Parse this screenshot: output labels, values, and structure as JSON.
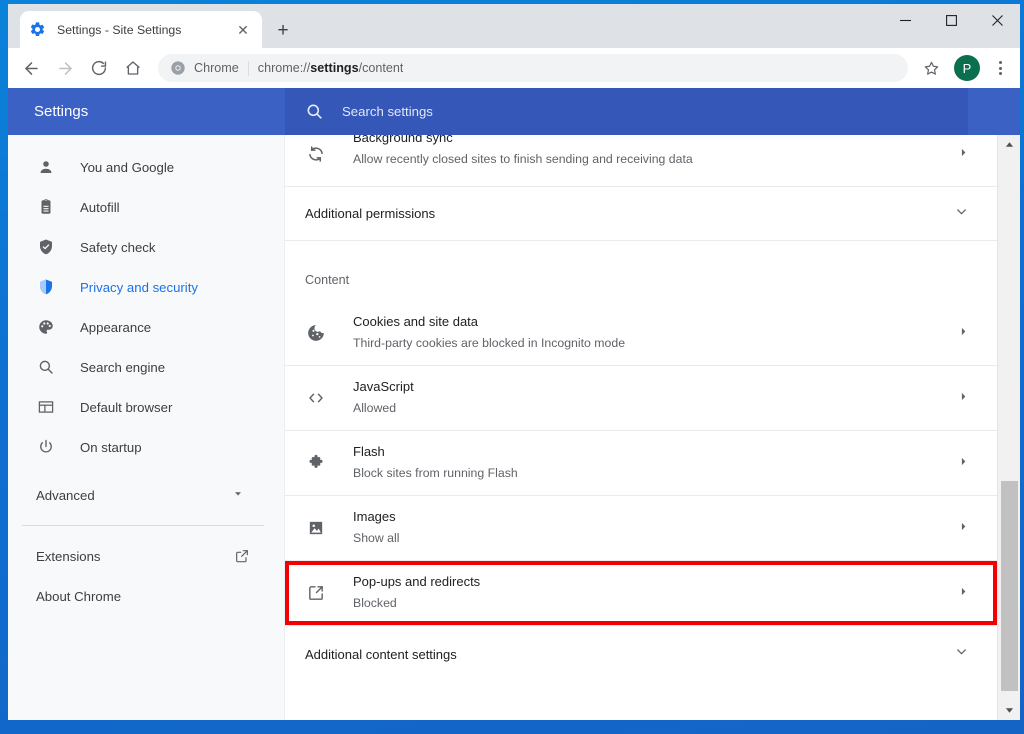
{
  "window": {
    "controls": {
      "minimize": "minimize-icon",
      "maximize": "maximize-icon",
      "close": "close-icon"
    }
  },
  "tab": {
    "title": "Settings - Site Settings",
    "favicon": "gear-icon",
    "close_label": "✕",
    "new_tab_label": "+"
  },
  "toolbar": {
    "back": "back-arrow-icon",
    "forward": "forward-arrow-icon",
    "reload": "reload-icon",
    "home": "home-icon",
    "omnibox": {
      "scheme_label": "Chrome",
      "url_prefix": "chrome://",
      "url_bold": "settings",
      "url_suffix": "/content",
      "full_url": "chrome://settings/content"
    },
    "bookmark": "star-icon",
    "profile_initial": "P",
    "menu": "three-dot-menu-icon"
  },
  "settings_header": {
    "title": "Settings",
    "search_placeholder": "Search settings",
    "search_icon": "search-icon",
    "bg_color": "#3b61c4",
    "search_bg_color": "#3557b8"
  },
  "sidebar": {
    "items": [
      {
        "label": "You and Google",
        "icon": "person-icon",
        "active": false
      },
      {
        "label": "Autofill",
        "icon": "clipboard-icon",
        "active": false
      },
      {
        "label": "Safety check",
        "icon": "shield-check-icon",
        "active": false
      },
      {
        "label": "Privacy and security",
        "icon": "shield-icon",
        "active": true
      },
      {
        "label": "Appearance",
        "icon": "palette-icon",
        "active": false
      },
      {
        "label": "Search engine",
        "icon": "search-icon",
        "active": false
      },
      {
        "label": "Default browser",
        "icon": "browser-window-icon",
        "active": false
      },
      {
        "label": "On startup",
        "icon": "power-icon",
        "active": false
      }
    ],
    "advanced": {
      "label": "Advanced",
      "chevron": "chevron-down-icon"
    },
    "bottom_items": [
      {
        "label": "Extensions",
        "icon": "external-link-icon"
      },
      {
        "label": "About Chrome",
        "icon": null
      }
    ],
    "active_color": "#1a73e8"
  },
  "main": {
    "clipped_row": {
      "title": "Background sync",
      "subtitle": "Allow recently closed sites to finish sending and receiving data",
      "icon": "sync-icon",
      "arrow": "chevron-right-icon"
    },
    "additional_permissions": {
      "label": "Additional permissions",
      "chevron": "chevron-down-icon"
    },
    "content_heading": "Content",
    "content_rows": [
      {
        "title": "Cookies and site data",
        "subtitle": "Third-party cookies are blocked in Incognito mode",
        "icon": "cookie-icon",
        "arrow": "chevron-right-icon",
        "highlighted": false
      },
      {
        "title": "JavaScript",
        "subtitle": "Allowed",
        "icon": "code-brackets-icon",
        "arrow": "chevron-right-icon",
        "highlighted": false
      },
      {
        "title": "Flash",
        "subtitle": "Block sites from running Flash",
        "icon": "puzzle-piece-icon",
        "arrow": "chevron-right-icon",
        "highlighted": false
      },
      {
        "title": "Images",
        "subtitle": "Show all",
        "icon": "image-icon",
        "arrow": "chevron-right-icon",
        "highlighted": false
      },
      {
        "title": "Pop-ups and redirects",
        "subtitle": "Blocked",
        "icon": "external-link-icon",
        "arrow": "chevron-right-icon",
        "highlighted": true
      }
    ],
    "additional_content_settings": {
      "label": "Additional content settings",
      "chevron": "chevron-down-icon"
    }
  },
  "annotation": {
    "color": "#f40000",
    "target": "Pop-ups and redirects"
  },
  "scrollbar": {
    "up_arrow": "caret-up-icon",
    "down_arrow": "caret-down-icon"
  }
}
